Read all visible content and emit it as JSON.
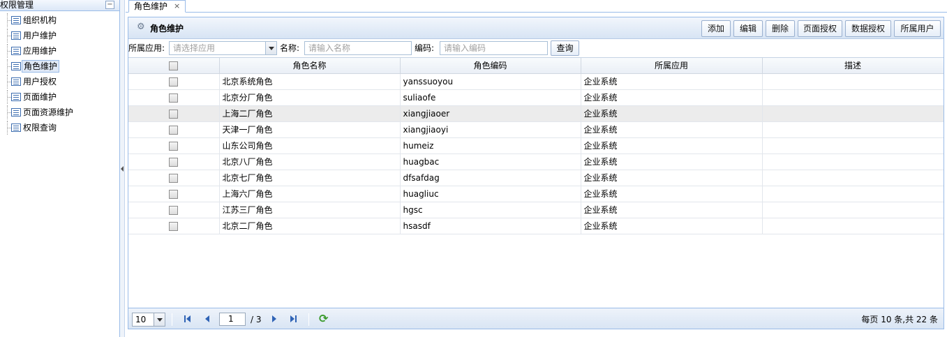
{
  "left_panel": {
    "title": "权限管理",
    "collapse_symbol": "−",
    "items": [
      {
        "label": "组织机构",
        "icon": "list-icon"
      },
      {
        "label": "用户维护",
        "icon": "list-icon"
      },
      {
        "label": "应用维护",
        "icon": "list-icon"
      },
      {
        "label": "角色维护",
        "icon": "list-icon",
        "selected": true
      },
      {
        "label": "用户授权",
        "icon": "list-icon"
      },
      {
        "label": "页面维护",
        "icon": "list-icon"
      },
      {
        "label": "页面资源维护",
        "icon": "list-icon"
      },
      {
        "label": "权限查询",
        "icon": "list-icon"
      }
    ]
  },
  "tab": {
    "label": "角色维护",
    "close": "×"
  },
  "panel": {
    "icon": "gear-icon",
    "title": "角色维护",
    "toolbar": {
      "add": "添加",
      "edit": "编辑",
      "delete": "删除",
      "page_auth": "页面授权",
      "data_auth": "数据授权",
      "users": "所属用户"
    }
  },
  "search": {
    "app_label": "所属应用:",
    "app_placeholder": "请选择应用",
    "name_label": "名称:",
    "name_placeholder": "请输入名称",
    "code_label": "编码:",
    "code_placeholder": "请输入编码",
    "query_button": "查询"
  },
  "grid": {
    "columns": [
      "角色名称",
      "角色编码",
      "所属应用",
      "描述"
    ],
    "rows": [
      {
        "name": "北京系统角色",
        "code": "yanssuoyou",
        "app": "企业系统",
        "desc": ""
      },
      {
        "name": "北京分厂角色",
        "code": "suliaofe",
        "app": "企业系统",
        "desc": ""
      },
      {
        "name": "上海二厂角色",
        "code": "xiangjiaoer",
        "app": "企业系统",
        "desc": ""
      },
      {
        "name": "天津一厂角色",
        "code": "xiangjiaoyi",
        "app": "企业系统",
        "desc": ""
      },
      {
        "name": "山东公司角色",
        "code": "humeiz",
        "app": "企业系统",
        "desc": ""
      },
      {
        "name": "北京八厂角色",
        "code": "huagbac",
        "app": "企业系统",
        "desc": ""
      },
      {
        "name": "北京七厂角色",
        "code": "dfsafdag",
        "app": "企业系统",
        "desc": ""
      },
      {
        "name": "上海六厂角色",
        "code": "huagliuc",
        "app": "企业系统",
        "desc": ""
      },
      {
        "name": "江苏三厂角色",
        "code": "hgsc",
        "app": "企业系统",
        "desc": ""
      },
      {
        "name": "北京二厂角色",
        "code": "hsasdf",
        "app": "企业系统",
        "desc": ""
      }
    ]
  },
  "pager": {
    "page_size": "10",
    "current_page": "1",
    "total_pages": "/ 3",
    "info": "每页 10 条,共 22 条"
  },
  "colors": {
    "border": "#99bbe8",
    "header_bg": "#dbe7f7",
    "highlight_row": "#ececec"
  }
}
